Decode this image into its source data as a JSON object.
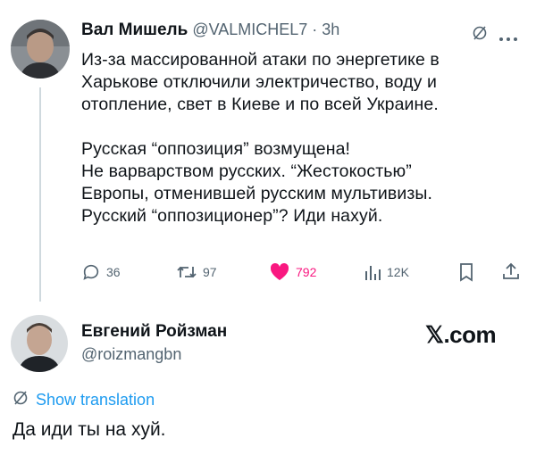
{
  "tweet": {
    "author_name": "Вал Мишель",
    "author_handle": "@VALMICHEL7",
    "separator": "·",
    "time": "3h",
    "text": "Из-за массированной атаки по энергетике в\nХарькове отключили электричество, воду и\nотопление, свет в Киеве и по всей Украине.\n\nРусская “оппозиция” возмущена!\nНе варварством русских. “Жестокостью”\nЕвропы, отменившей русским мультивизы.\nРусский “оппозиционер”? Иди нахуй.",
    "actions": {
      "replies": "36",
      "retweets": "97",
      "likes": "792",
      "views": "12K"
    },
    "like_color": "#f91880",
    "icons": [
      "grok-icon",
      "more-icon",
      "reply-icon",
      "retweet-icon",
      "heart-icon",
      "views-icon",
      "bookmark-icon",
      "share-icon"
    ]
  },
  "reply": {
    "author_name": "Евгений Ройзман",
    "author_handle": "@roizmangbn",
    "brand": "𝕏.com",
    "translate_label": "Show translation",
    "text": "Да иди ты на хуй.",
    "link_color": "#1d9bf0"
  }
}
